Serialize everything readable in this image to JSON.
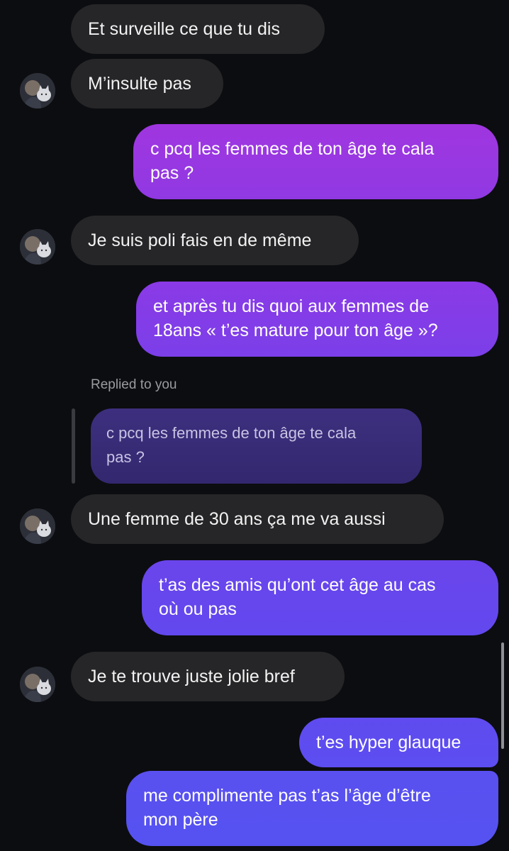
{
  "colors": {
    "background": "#0c0d10",
    "incoming_bubble": "#262628",
    "outgoing_gradient_top": "#a036e0",
    "outgoing_gradient_bottom": "#5c52f0"
  },
  "messages": [
    {
      "direction": "incoming",
      "text": "Et surveille ce que tu dis"
    },
    {
      "direction": "incoming",
      "text": "M’insulte pas",
      "avatar": "contact-avatar"
    },
    {
      "direction": "outgoing",
      "text": "c pcq les femmes de ton âge te cala\npas ?"
    },
    {
      "direction": "incoming",
      "text": "Je suis poli fais en de même",
      "avatar": "contact-avatar"
    },
    {
      "direction": "outgoing",
      "text": "et après tu dis quoi aux femmes de\n18ans « t’es mature pour ton âge »?"
    },
    {
      "direction": "incoming",
      "text": "Une femme de 30 ans ça me va aussi",
      "avatar": "contact-avatar"
    },
    {
      "direction": "outgoing",
      "text": "t’as des amis qu’ont cet âge au cas\noù ou pas"
    },
    {
      "direction": "incoming",
      "text": "Je te trouve juste jolie bref",
      "avatar": "contact-avatar"
    },
    {
      "direction": "outgoing",
      "text": "t’es hyper glauque"
    },
    {
      "direction": "outgoing",
      "text": "me complimente pas t’as l’âge d’être\nmon père"
    }
  ],
  "reply": {
    "label": "Replied to you",
    "quoted_text": "c pcq les femmes de ton âge te cala\npas ?"
  }
}
